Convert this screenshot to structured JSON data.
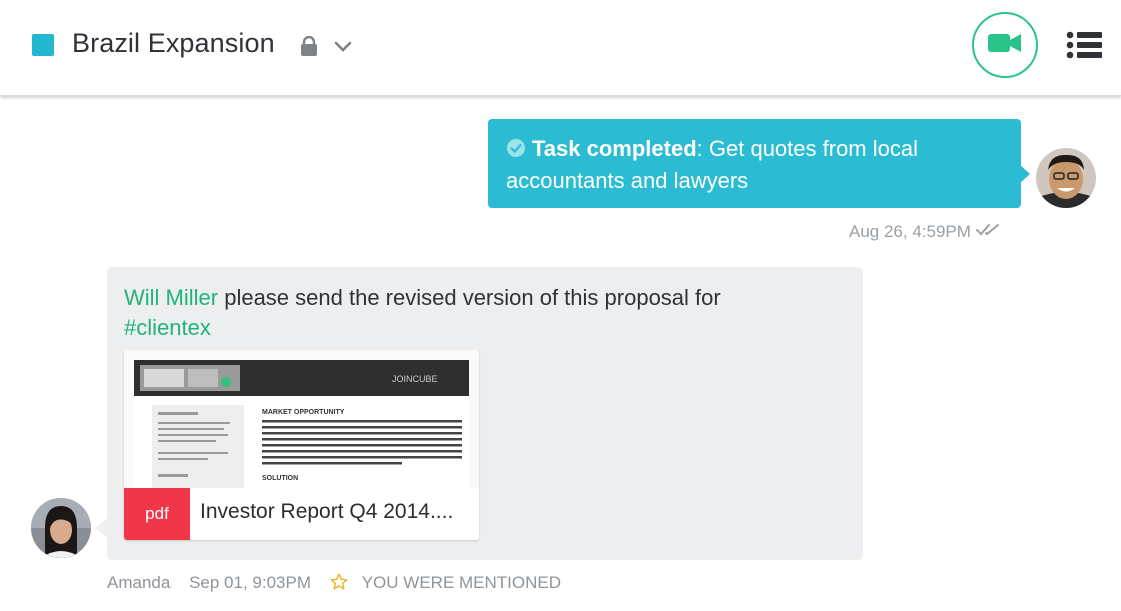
{
  "header": {
    "channel_title": "Brazil Expansion",
    "channel_color": "#22b8d1",
    "lock_icon": "lock-icon",
    "dropdown_icon": "chevron-down-icon",
    "video_icon": "video-camera-icon",
    "menu_icon": "list-menu-icon"
  },
  "outgoing": {
    "status_label": "Task completed",
    "separator": ":",
    "task_text": " Get quotes from local accountants and lawyers",
    "timestamp": "Aug 26, 4:59PM",
    "read_icon": "double-check-icon",
    "bubble_color": "#2bbcd4"
  },
  "incoming": {
    "mention": "Will Miller",
    "message": " please send the revised version of this proposal for ",
    "hashtag": "#clientex",
    "attachment": {
      "type_label": "pdf",
      "file_name": "Investor Report Q4 2014....",
      "thumbnail_logo": "JOINCUBE",
      "thumbnail_heading_1": "MARKET OPPORTUNITY",
      "thumbnail_heading_2": "SOLUTION"
    },
    "sender": "Amanda",
    "timestamp": "Sep 01, 9:03PM",
    "mention_badge": "YOU WERE MENTIONED",
    "accent_color": "#22b37a"
  }
}
